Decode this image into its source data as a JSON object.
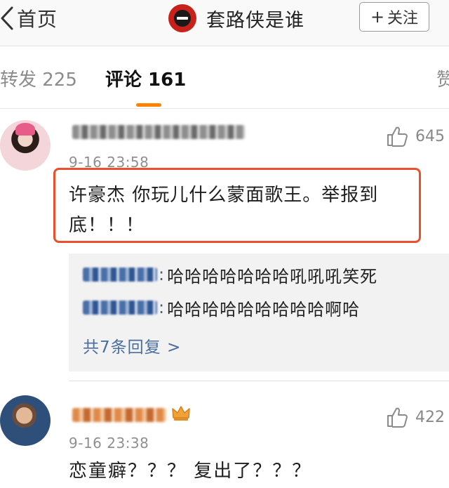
{
  "header": {
    "back_label": "首页",
    "title": "套路侠是谁",
    "follow_label": "关注"
  },
  "tabs": {
    "repost": "转发 225",
    "comment": "评论 161",
    "like": "赞"
  },
  "colors": {
    "accent_orange": "#ff8200",
    "highlight_red": "#e8502e",
    "link_blue": "#4a6ea0",
    "muted_gray": "#8f8f8f"
  },
  "comments": [
    {
      "time": "9-16 23:58",
      "likes": "645",
      "text": "许豪杰 你玩儿什么蒙面歌王。举报到底！！！",
      "replies": [
        {
          "text": "哈哈哈哈哈哈哈吼吼吼笑死"
        },
        {
          "text": "哈哈哈哈哈哈哈哈哈啊哈"
        }
      ],
      "more_replies": "共7条回复 >"
    },
    {
      "time": "9-16 23:38",
      "likes": "422",
      "text": "恋童癖？？？ 复出了？？？"
    }
  ]
}
